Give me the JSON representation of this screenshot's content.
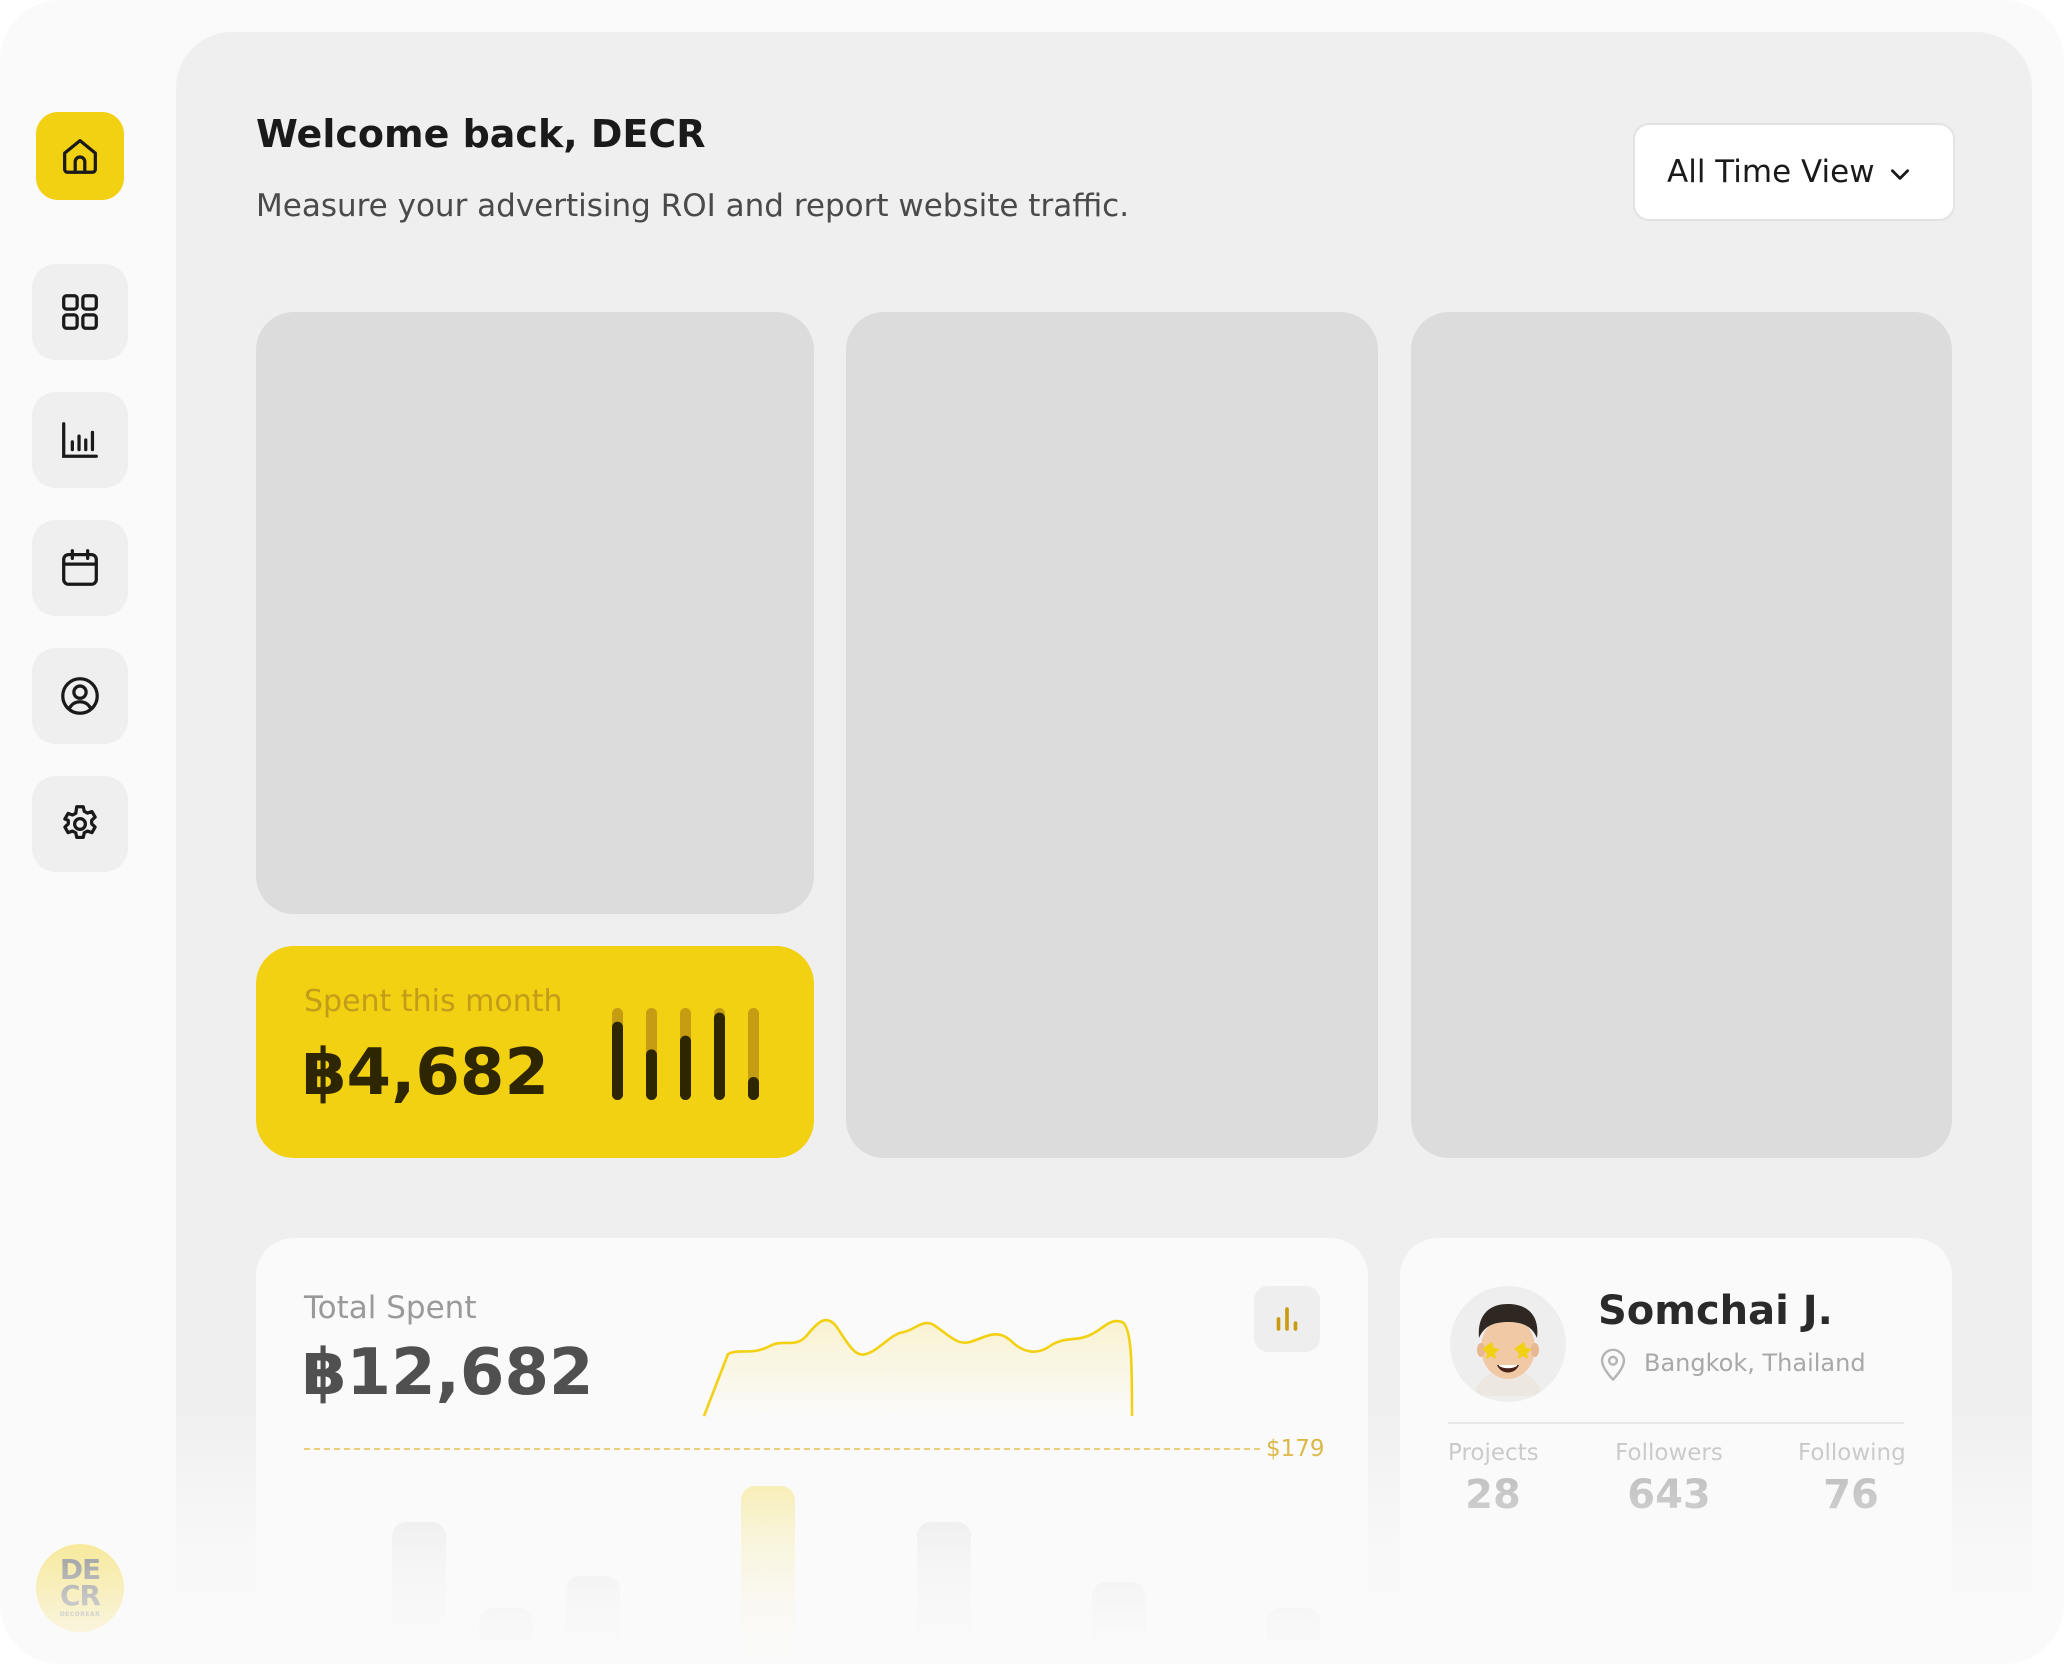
{
  "header": {
    "title": "Welcome back, DECR",
    "subtitle": "Measure your advertising ROI and report website traffic."
  },
  "view_select": {
    "selected": "All Time View",
    "icon": "chevron-down-icon"
  },
  "sidebar": {
    "items": [
      {
        "name": "home",
        "icon": "home-icon",
        "active": true
      },
      {
        "name": "dashboard",
        "icon": "grid-icon",
        "active": false
      },
      {
        "name": "analytics",
        "icon": "bar-chart-icon",
        "active": false
      },
      {
        "name": "calendar",
        "icon": "calendar-icon",
        "active": false
      },
      {
        "name": "profile",
        "icon": "user-circle-icon",
        "active": false
      },
      {
        "name": "settings",
        "icon": "gear-icon",
        "active": false
      }
    ],
    "logo": {
      "line1": "DE",
      "line2": "CR",
      "tagline": "DECOREAR"
    }
  },
  "spent_card": {
    "label": "Spent this month",
    "value": "฿4,682",
    "bars": [
      0.85,
      0.55,
      0.7,
      0.95,
      0.25
    ]
  },
  "total_card": {
    "label": "Total Spent",
    "value": "฿12,682",
    "average_label": "$179",
    "icon": "bar-chart-icon"
  },
  "profile": {
    "name": "Somchai J.",
    "location": "Bangkok, Thailand",
    "stats": [
      {
        "label": "Projects",
        "value": "28"
      },
      {
        "label": "Followers",
        "value": "643"
      },
      {
        "label": "Following",
        "value": "76"
      }
    ]
  },
  "colors": {
    "accent": "#f2d012",
    "background": "#efefef",
    "placeholder": "#dcdcdc",
    "dark": "#2e2600"
  }
}
